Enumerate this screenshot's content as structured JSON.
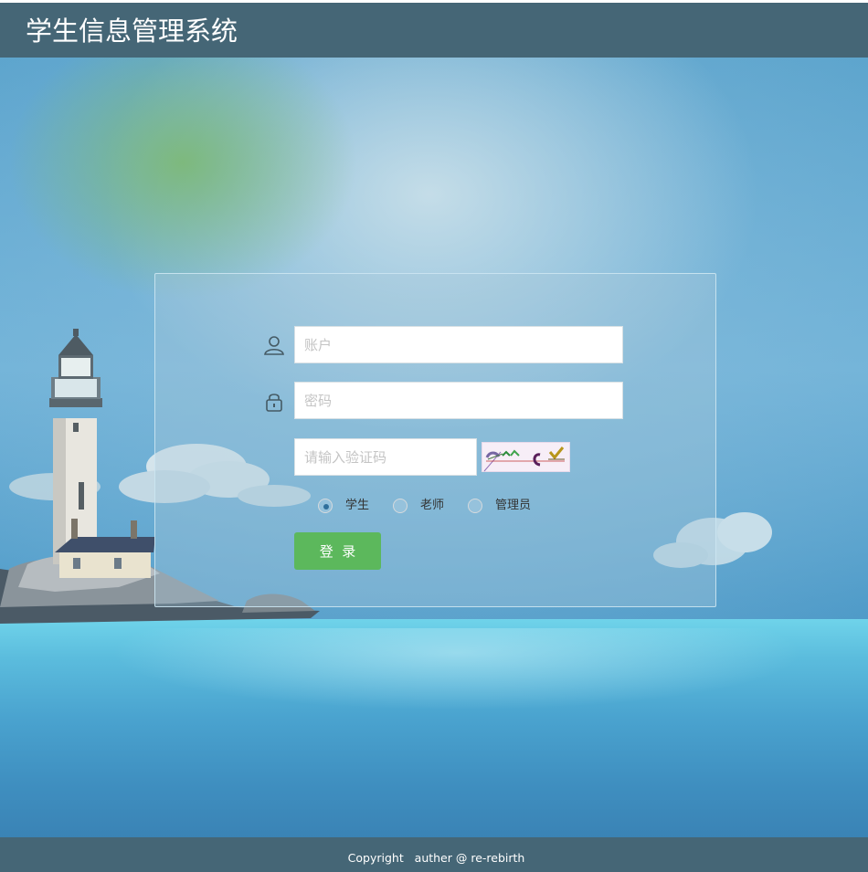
{
  "header": {
    "title": "学生信息管理系统"
  },
  "login": {
    "account_placeholder": "账户",
    "password_placeholder": "密码",
    "captcha_placeholder": "请输入验证码",
    "roles": [
      {
        "label": "学生",
        "selected": true
      },
      {
        "label": "老师",
        "selected": false
      },
      {
        "label": "管理员",
        "selected": false
      }
    ],
    "submit_label": "登  录"
  },
  "icons": {
    "account": "user-icon",
    "password": "lock-icon"
  },
  "footer": {
    "copyright": "Copyright   auther @ re-rebirth"
  },
  "colors": {
    "header_bg": "#456676",
    "login_button": "#5cb85c"
  }
}
